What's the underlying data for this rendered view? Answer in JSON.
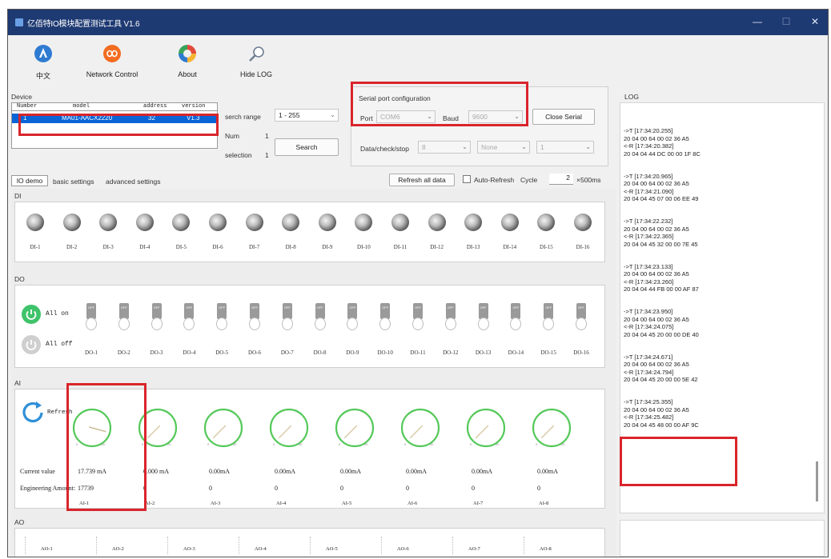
{
  "window": {
    "title": "亿佰特IO模块配置测试工具 V1.6",
    "min": "—",
    "max": "☐",
    "close": "✕"
  },
  "toolbar": [
    {
      "label": "中文",
      "icon": "language-icon",
      "color": "#2f7bd1"
    },
    {
      "label": "Network Control",
      "icon": "network-icon",
      "color": "#f26c21"
    },
    {
      "label": "About",
      "icon": "about-icon",
      "color": "#e24a3d"
    },
    {
      "label": "Hide LOG",
      "icon": "magnifier-icon",
      "color": "#6d7d92"
    }
  ],
  "device": {
    "group": "Device",
    "columns": [
      "Number",
      "model",
      "address",
      "version"
    ],
    "row": [
      "1",
      "MA01-AACX2220",
      "32",
      "V1.3"
    ],
    "search_range_label": "serch range",
    "search_range": "1 - 255",
    "num_label": "Num",
    "num": "1",
    "selection_label": "selection",
    "selection": "1",
    "search_button": "Search"
  },
  "serial": {
    "group": "Serial port configuration",
    "port_label": "Port",
    "port": "COM6",
    "baud_label": "Baud",
    "baud": "9600",
    "close_button": "Close Serial",
    "dcs_label": "Data/check/stop",
    "data_bits": "8",
    "parity": "None",
    "stop_bits": "1"
  },
  "tabs": [
    "IO demo",
    "basic settings",
    "advanced settings"
  ],
  "refresh_all": "Refresh all data",
  "auto_refresh": "Auto-Refresh",
  "cycle_label": "Cycle",
  "cycle": "2",
  "cycle_unit": "×500ms",
  "di": {
    "label": "DI",
    "items": [
      "DI-1",
      "DI-2",
      "DI-3",
      "DI-4",
      "DI-5",
      "DI-6",
      "DI-7",
      "DI-8",
      "DI-9",
      "DI-10",
      "DI-11",
      "DI-12",
      "DI-13",
      "DI-14",
      "DI-15",
      "DI-16"
    ]
  },
  "do": {
    "label": "DO",
    "all_on": "All on",
    "all_off": "All off",
    "state": "OFF",
    "items": [
      "DO-1",
      "DO-2",
      "DO-3",
      "DO-4",
      "DO-5",
      "DO-6",
      "DO-7",
      "DO-8",
      "DO-9",
      "DO-10",
      "DO-11",
      "DO-12",
      "DO-13",
      "DO-14",
      "DO-15",
      "DO-16"
    ]
  },
  "ai": {
    "label": "AI",
    "refresh": "Refresh",
    "current_label": "Current value",
    "eng_label": "Engineering Amount:",
    "items": [
      {
        "name": "AI-1",
        "current": "17.739 mA",
        "eng": "17739",
        "level": 0.89
      },
      {
        "name": "AI-2",
        "current": "0.000 mA",
        "eng": "0",
        "level": 0
      },
      {
        "name": "AI-3",
        "current": "0.00mA",
        "eng": "0",
        "level": 0
      },
      {
        "name": "AI-4",
        "current": "0.00mA",
        "eng": "0",
        "level": 0
      },
      {
        "name": "AI-5",
        "current": "0.00mA",
        "eng": "0",
        "level": 0
      },
      {
        "name": "AI-6",
        "current": "0.00mA",
        "eng": "0",
        "level": 0
      },
      {
        "name": "AI-7",
        "current": "0.00mA",
        "eng": "0",
        "level": 0
      },
      {
        "name": "AI-8",
        "current": "0.00mA",
        "eng": "0",
        "level": 0
      }
    ],
    "scale_min": "0",
    "scale_max": "20"
  },
  "ao": {
    "label": "AO",
    "items": [
      "AO-1",
      "AO-2",
      "AO-3",
      "AO-4",
      "AO-5",
      "AO-6",
      "AO-7",
      "AO-8"
    ]
  },
  "log": {
    "label": "LOG",
    "entries": [
      "->T [17:34:20.255]\n20 04 00 64 00 02 36 A5\n<-R [17:34:20.382]\n20 04 04 44 DC 00 00 1F 8C",
      "->T [17:34:20.965]\n20 04 00 64 00 02 36 A5\n<-R [17:34:21.090]\n20 04 04 45 07 00 06 EE 49",
      "->T [17:34:22.232]\n20 04 00 64 00 02 36 A5\n<-R [17:34:22.365]\n20 04 04 45 32 00 00 7E 45",
      "->T [17:34:23.133]\n20 04 00 64 00 02 36 A5\n<-R [17:34:23.260]\n20 04 04 44 FB 00 00 AF 87",
      "->T [17:34:23.950]\n20 04 00 64 00 02 36 A5\n<-R [17:34:24.075]\n20 04 04 45 20 00 00 DE 40",
      "->T [17:34:24.671]\n20 04 00 64 00 02 36 A5\n<-R [17:34:24.794]\n20 04 04 45 20 00 00 5E 42",
      "->T [17:34:25.355]\n20 04 00 64 00 02 36 A5\n<-R [17:34:25.482]\n20 04 04 45 48 00 00 AF 9C"
    ]
  },
  "colors": {
    "title_bg": "#1e3a73",
    "selection": "#0a64d6",
    "highlight": "#d9252b",
    "gauge": "#55c95a",
    "green_btn": "#3fc36b",
    "refresh": "#2f8fd8"
  }
}
